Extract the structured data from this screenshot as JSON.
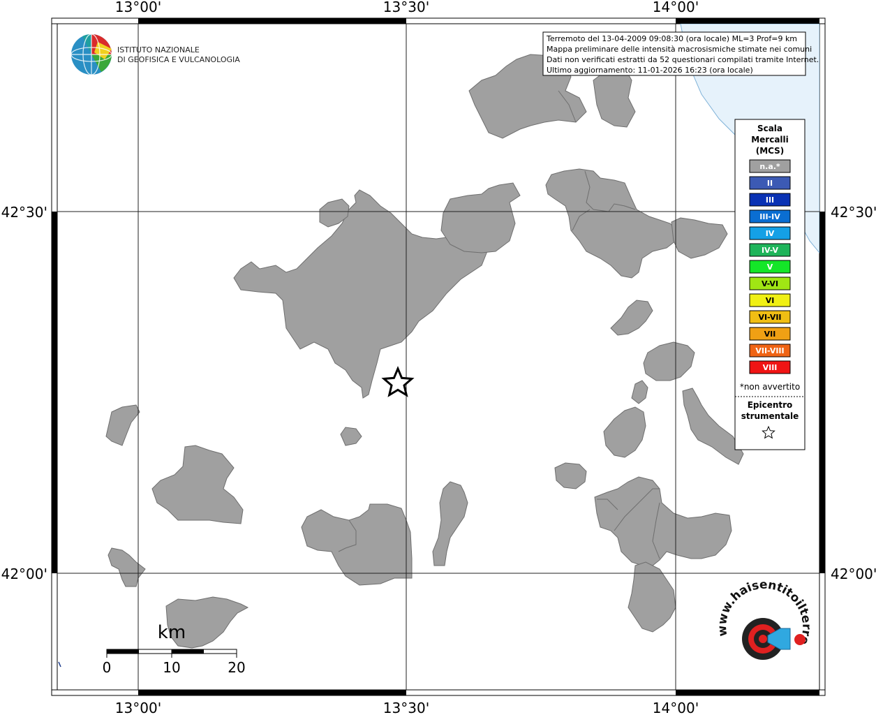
{
  "map": {
    "grid": {
      "lon_labels": [
        "13°00'",
        "13°30'",
        "14°00'"
      ],
      "lat_labels": [
        "42°30'",
        "42°00'"
      ]
    },
    "sea_color": "#e6f2fb",
    "region_color": "#a0a0a0"
  },
  "logo_ingv": {
    "line1": "ISTITUTO NAZIONALE",
    "line2": "DI GEOFISICA E VULCANOLOGIA"
  },
  "info_box": {
    "lines": [
      "Terremoto del 13-04-2009 09:08:30 (ora locale) ML=3 Prof=9 km",
      "Mappa preliminare delle intensità macrosismiche stimate nei comuni",
      "Dati non verificati estratti da 52 questionari compilati tramite Internet.",
      "Ultimo aggiornamento: 11-01-2026 16:23 (ora locale)"
    ]
  },
  "legend": {
    "title_lines": [
      "Scala",
      "Mercalli",
      "(MCS)"
    ],
    "items": [
      {
        "label": "n.a.*",
        "color": "#a0a0a0"
      },
      {
        "label": "II",
        "color": "#3c5ab4"
      },
      {
        "label": "III",
        "color": "#0a32b4"
      },
      {
        "label": "III-IV",
        "color": "#0a6ed2"
      },
      {
        "label": "IV",
        "color": "#14a0e6"
      },
      {
        "label": "IV-V",
        "color": "#1eb45a"
      },
      {
        "label": "V",
        "color": "#14e628"
      },
      {
        "label": "V-VI",
        "color": "#a0e614"
      },
      {
        "label": "VI",
        "color": "#f0f014"
      },
      {
        "label": "VI-VII",
        "color": "#f0be14"
      },
      {
        "label": "VII",
        "color": "#f0a014"
      },
      {
        "label": "VII-VIII",
        "color": "#f06414"
      },
      {
        "label": "VIII",
        "color": "#f01414"
      }
    ],
    "note": "*non avvertito",
    "epicenter_lines": [
      "Epicentro",
      "strumentale"
    ]
  },
  "scale_bar": {
    "unit": "km",
    "labels": [
      "0",
      "10",
      "20"
    ]
  },
  "logo_hsit": {
    "text": "www.haisentitoilterremoto.it"
  }
}
